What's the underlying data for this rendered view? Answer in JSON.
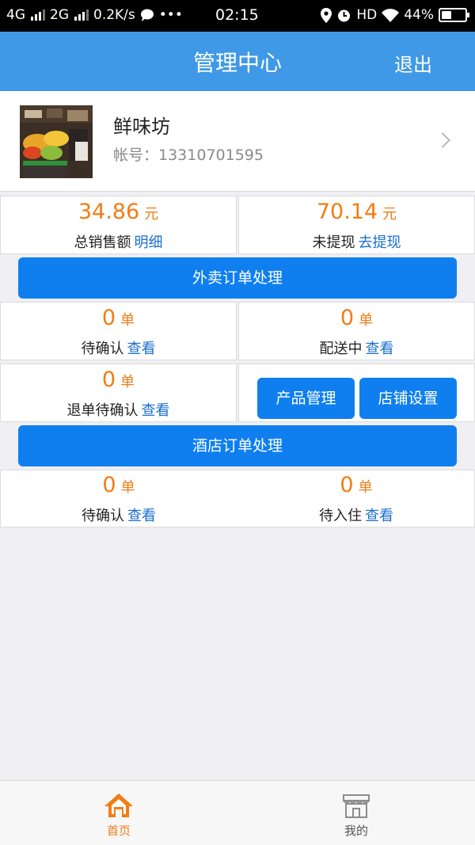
{
  "status_bar": {
    "network1": "4G",
    "network2": "2G",
    "speed": "0.2K/s",
    "dots": "•••",
    "time": "02:15",
    "hd": "HD",
    "battery": "44%",
    "battery_level": 0.44
  },
  "header": {
    "title": "管理中心",
    "logout_label": "退出"
  },
  "profile": {
    "store_name": "鲜味坊",
    "account_text": "帐号：13310701595"
  },
  "sales": {
    "total_value": "34.86",
    "unit_yuan": "元",
    "total_label": "总销售额",
    "detail_link": "明细",
    "pending_value": "70.14",
    "pending_label": "未提现",
    "withdraw_link": "去提现"
  },
  "takeout": {
    "section_button": "外卖订单处理",
    "unit_order": "单",
    "view_link": "查看",
    "confirm_count": "0",
    "confirm_label": "待确认",
    "delivering_count": "0",
    "delivering_label": "配送中",
    "refund_count": "0",
    "refund_label": "退单待确认",
    "product_mgmt": "产品管理",
    "shop_settings": "店铺设置"
  },
  "hotel": {
    "section_button": "酒店订单处理",
    "confirm_count": "0",
    "confirm_label": "待确认",
    "checkin_count": "0",
    "checkin_label": "待入住"
  },
  "tabbar": {
    "home_label": "首页",
    "mine_label": "我的"
  },
  "colors": {
    "header": "#3f99e6",
    "button": "#0f7ff0",
    "accent_orange": "#f07d14",
    "link": "#1a6fcf"
  }
}
